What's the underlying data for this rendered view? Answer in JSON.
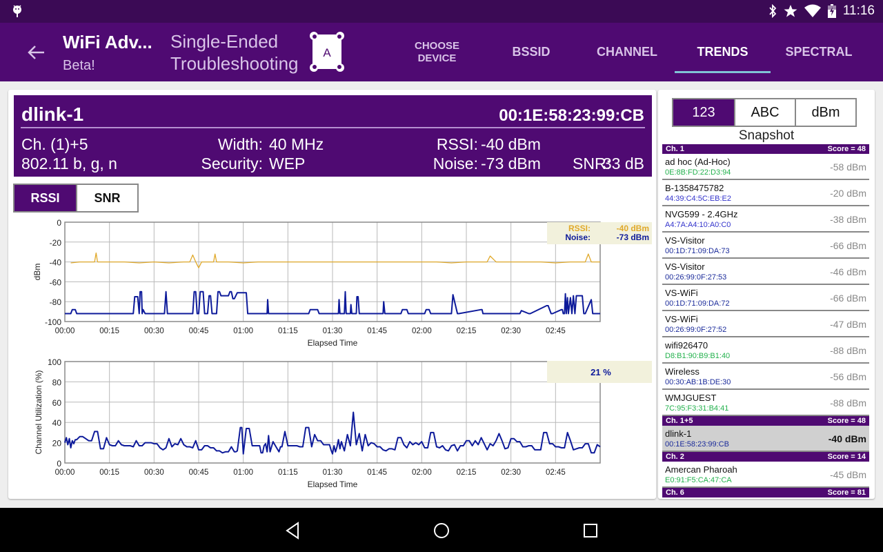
{
  "status_bar": {
    "time": "11:16",
    "icons": [
      "android-debug-icon",
      "bluetooth-icon",
      "star-icon",
      "wifi-icon",
      "battery-charging-icon"
    ]
  },
  "app_bar": {
    "title": "WiFi Adv...",
    "subtitle": "Beta!",
    "mode_line1": "Single-Ended",
    "mode_line2": "Troubleshooting",
    "device_badge": "A",
    "tabs": [
      {
        "label_line1": "CHOOSE",
        "label_line2": "DEVICE",
        "active": false
      },
      {
        "label": "BSSID",
        "active": false
      },
      {
        "label": "CHANNEL",
        "active": false
      },
      {
        "label": "TRENDS",
        "active": true
      },
      {
        "label": "SPECTRAL",
        "active": false
      }
    ]
  },
  "network_info": {
    "ssid": "dlink-1",
    "bssid": "00:1E:58:23:99:CB",
    "channel": "Ch. (1)+5",
    "standards": "802.11 b, g, n",
    "width_label": "Width:",
    "width_value": "40 MHz",
    "security_label": "Security:",
    "security_value": "WEP",
    "rssi_label": "RSSI:",
    "rssi_value": "-40 dBm",
    "noise_label": "Noise:",
    "noise_value": "-73 dBm",
    "snr_label": "SNR:",
    "snr_value": "33 dB"
  },
  "chart_toggle": {
    "options": [
      "RSSI",
      "SNR"
    ],
    "selected": "RSSI"
  },
  "colors": {
    "brand": "#4f0a72",
    "rssi": "#e0a92a",
    "noise": "#0d1a9a",
    "legend_bg": "#f2f1dc"
  },
  "chart_data": [
    {
      "type": "line",
      "title": "",
      "xlabel": "Elapsed Time",
      "ylabel": "dBm",
      "ylim": [
        -100,
        0
      ],
      "xlim_minutes": [
        0,
        180
      ],
      "yticks": [
        "0",
        "-20",
        "-40",
        "-60",
        "-80",
        "-100"
      ],
      "xticks": [
        "00:00",
        "00:15",
        "00:30",
        "00:45",
        "01:00",
        "01:15",
        "01:30",
        "01:45",
        "02:00",
        "02:15",
        "02:30",
        "02:45"
      ],
      "grid": true,
      "legend": {
        "placement": "top-right",
        "entries": [
          {
            "label": "RSSI:",
            "value": "-40 dBm"
          },
          {
            "label": "Noise:",
            "value": "-73 dBm"
          }
        ]
      },
      "series": [
        {
          "name": "RSSI",
          "x_minutes": [
            2,
            5,
            8,
            10,
            10.5,
            11,
            14,
            20,
            25,
            30,
            35,
            40,
            42,
            43,
            44,
            45,
            46,
            47,
            50,
            50.5,
            51,
            52,
            55,
            60,
            65,
            70,
            75,
            80,
            85,
            90,
            95,
            100,
            105,
            110,
            115,
            120,
            125,
            130,
            135,
            140,
            142,
            143,
            145,
            150,
            155,
            160,
            165,
            170,
            175,
            176,
            177,
            180
          ],
          "values": [
            -41,
            -40,
            -40,
            -40,
            -31,
            -40,
            -40,
            -40,
            -41,
            -40,
            -41,
            -40,
            -40,
            -33,
            -40,
            -46,
            -40,
            -40,
            -40,
            -32,
            -40,
            -40,
            -40,
            -41,
            -40,
            -40,
            -40,
            -40,
            -40,
            -40,
            -40,
            -40,
            -40,
            -40,
            -40,
            -40,
            -40,
            -41,
            -40,
            -40,
            -40,
            -34,
            -40,
            -40,
            -40,
            -40,
            -41,
            -40,
            -40,
            -32,
            -40,
            -40
          ]
        },
        {
          "name": "Noise",
          "x_minutes": [
            0,
            2,
            2.5,
            3.5,
            4,
            23,
            23.5,
            24.5,
            25,
            25.3,
            25.8,
            26,
            26.3,
            27,
            33.5,
            34,
            34.5,
            35,
            40,
            40.5,
            43,
            43.5,
            44,
            44.5,
            45,
            45.5,
            46.5,
            47,
            48,
            48.5,
            49,
            49.5,
            51,
            51.5,
            52,
            52.5,
            53,
            55,
            55.5,
            56,
            56.5,
            57,
            58,
            58.5,
            60,
            61,
            61.5,
            62,
            68,
            68.2,
            68.5,
            82,
            82.5,
            85,
            85.5,
            92,
            92.2,
            92.5,
            94,
            94.3,
            94.6,
            95,
            96,
            96.2,
            96.5,
            98,
            98.2,
            98.6,
            99,
            107,
            107.2,
            107.6,
            113,
            113.5,
            115,
            115.5,
            116,
            121,
            121.5,
            122.5,
            123,
            130,
            130.5,
            132,
            132.5,
            140,
            140.3,
            140.6,
            153,
            153.5,
            156,
            156.5,
            162,
            162.5,
            163.5,
            164,
            167,
            167.3,
            167.6,
            168,
            168.3,
            168.6,
            169,
            169.3,
            170,
            170.5,
            171,
            171.5,
            172,
            174,
            174.5,
            175,
            177,
            177.5,
            180
          ],
          "values": [
            -92,
            -92,
            -88,
            -88,
            -92,
            -92,
            -75,
            -75,
            -92,
            -70,
            -70,
            -92,
            -88,
            -92,
            -92,
            -70,
            -92,
            -92,
            -92,
            -92,
            -92,
            -70,
            -70,
            -92,
            -92,
            -70,
            -70,
            -92,
            -92,
            -74,
            -74,
            -92,
            -92,
            -70,
            -70,
            -74,
            -74,
            -74,
            -70,
            -70,
            -77,
            -77,
            -71,
            -71,
            -71,
            -71,
            -92,
            -92,
            -92,
            -78,
            -92,
            -92,
            -88,
            -88,
            -92,
            -92,
            -78,
            -92,
            -92,
            -70,
            -92,
            -92,
            -92,
            -83,
            -92,
            -92,
            -75,
            -75,
            -92,
            -92,
            -80,
            -92,
            -92,
            -88,
            -88,
            -92,
            -92,
            -92,
            -88,
            -88,
            -92,
            -92,
            -73,
            -92,
            -92,
            -88,
            -88,
            -92,
            -92,
            -89,
            -92,
            -92,
            -84,
            -84,
            -92,
            -92,
            -88,
            -88,
            -92,
            -92,
            -72,
            -92,
            -76,
            -92,
            -76,
            -92,
            -74,
            -92,
            -74,
            -74,
            -92,
            -92,
            -78,
            -92,
            -92,
            -79,
            -79
          ]
        }
      ]
    },
    {
      "type": "line",
      "title": "",
      "xlabel": "Elapsed Time",
      "ylabel": "Channel Utilization (%)",
      "ylim": [
        0,
        100
      ],
      "xlim_minutes": [
        0,
        180
      ],
      "yticks": [
        "100",
        "80",
        "60",
        "40",
        "20",
        "0"
      ],
      "xticks": [
        "00:00",
        "00:15",
        "00:30",
        "00:45",
        "01:00",
        "01:15",
        "01:30",
        "01:45",
        "02:00",
        "02:15",
        "02:30",
        "02:45"
      ],
      "grid": true,
      "legend": {
        "placement": "top-right",
        "entries": [
          {
            "label": "",
            "value": "21 %"
          }
        ]
      },
      "series": [
        {
          "name": "Channel Utilization",
          "x_minutes": [
            0,
            0.5,
            1,
            1.5,
            2,
            2.5,
            3,
            3.5,
            4,
            5,
            6,
            7,
            8,
            9,
            10,
            11,
            12,
            13,
            14,
            15,
            16,
            17,
            18,
            19,
            20,
            21,
            22,
            23,
            24,
            25,
            26,
            27,
            28,
            29,
            30,
            31,
            32,
            33,
            34,
            35,
            36,
            37,
            38,
            39,
            40,
            41,
            42,
            43,
            44,
            45,
            46,
            47,
            48,
            49,
            50,
            51,
            52,
            53,
            54,
            55,
            56,
            57,
            57.5,
            58,
            59,
            59.5,
            60,
            61,
            62,
            63,
            64,
            65,
            65.5,
            66,
            66.5,
            67,
            67.5,
            68,
            68.5,
            69,
            70,
            71,
            72,
            72.5,
            73,
            74,
            75,
            76,
            77,
            78,
            79,
            80,
            81,
            82,
            83,
            84,
            85,
            86,
            87,
            88,
            88.5,
            89,
            89.5,
            90,
            90.5,
            91,
            91.5,
            92,
            92.5,
            93,
            94,
            95,
            96,
            97,
            98,
            99,
            100,
            101,
            102,
            103,
            104,
            105,
            106,
            107,
            108,
            109,
            110,
            111,
            112,
            113,
            114,
            115,
            116,
            117,
            118,
            119,
            120,
            121,
            122,
            123,
            124,
            125,
            126,
            127,
            128,
            129,
            130,
            131,
            132,
            133,
            134,
            135,
            136,
            137,
            138,
            139,
            140,
            141,
            142,
            143,
            144,
            145,
            146,
            147,
            148,
            149,
            150,
            151,
            152,
            153,
            154,
            155,
            156,
            157,
            158,
            159,
            160,
            161,
            162,
            163,
            164,
            165,
            166,
            167,
            168,
            169,
            170,
            171,
            172,
            173,
            174,
            175,
            176,
            177,
            178,
            179,
            180
          ],
          "values": [
            20,
            25,
            18,
            24,
            15,
            22,
            19,
            23,
            23,
            26,
            26,
            24,
            22,
            22,
            31,
            31,
            14,
            14,
            25,
            18,
            17,
            17,
            22,
            18,
            17,
            17,
            17,
            16,
            22,
            17,
            17,
            20,
            20,
            20,
            19,
            19,
            15,
            13,
            15,
            24,
            16,
            19,
            18,
            24,
            18,
            16,
            16,
            15,
            22,
            13,
            13,
            17,
            17,
            15,
            15,
            12,
            12,
            10,
            11,
            11,
            16,
            11,
            11,
            12,
            35,
            35,
            9,
            34,
            34,
            17,
            17,
            17,
            17,
            10,
            10,
            17,
            19,
            11,
            27,
            11,
            21,
            16,
            11,
            16,
            16,
            31,
            17,
            17,
            17,
            17,
            16,
            16,
            35,
            35,
            16,
            28,
            22,
            22,
            18,
            18,
            18,
            18,
            13,
            9,
            17,
            11,
            16,
            23,
            14,
            21,
            12,
            28,
            17,
            50,
            18,
            29,
            12,
            28,
            17,
            20,
            19,
            16,
            16,
            13,
            12,
            14,
            14,
            13,
            25,
            25,
            18,
            15,
            21,
            18,
            20,
            18,
            21,
            15,
            15,
            30,
            30,
            16,
            15,
            17,
            13,
            12,
            17,
            18,
            12,
            17,
            17,
            22,
            22,
            17,
            22,
            18,
            25,
            19,
            13,
            19,
            17,
            22,
            29,
            22,
            14,
            15,
            24,
            24,
            21,
            21,
            16,
            16,
            17,
            17,
            13,
            13,
            13,
            30,
            30,
            19,
            19,
            16,
            16,
            15,
            15,
            30,
            22,
            13,
            14,
            15,
            15,
            19,
            19,
            10,
            10,
            18,
            16,
            16,
            16,
            16,
            16,
            17,
            17,
            17,
            17,
            14,
            14,
            11,
            11,
            11,
            11,
            14,
            15,
            15,
            15,
            10,
            10,
            20,
            20,
            21,
            21
          ]
        }
      ]
    }
  ],
  "sidebar": {
    "sort_options": [
      "123",
      "ABC",
      "dBm"
    ],
    "sort_selected": "123",
    "title": "Snapshot",
    "groups": [
      {
        "channel": "Ch. 1",
        "score": "Score = 48",
        "networks": [
          {
            "name": "ad hoc (Ad-Hoc)",
            "mac": "0E:8B:FD:22:D3:94",
            "mac_color": "#22b14c",
            "dbm": "-58 dBm"
          },
          {
            "name": "B-1358475782",
            "mac": "44:39:C4:5C:EB:E2",
            "mac_color": "#3333cc",
            "dbm": "-20 dBm"
          },
          {
            "name": "NVG599 - 2.4GHz",
            "mac": "A4:7A:A4:10:A0:C0",
            "mac_color": "#3333cc",
            "dbm": "-38 dBm"
          },
          {
            "name": "VS-Visitor",
            "mac": "00:1D:71:09:DA:73",
            "mac_color": "#1a2a9a",
            "dbm": "-66 dBm"
          },
          {
            "name": "VS-Visitor",
            "mac": "00:26:99:0F:27:53",
            "mac_color": "#1a2a9a",
            "dbm": "-46 dBm"
          },
          {
            "name": "VS-WiFi",
            "mac": "00:1D:71:09:DA:72",
            "mac_color": "#1a2a9a",
            "dbm": "-66 dBm"
          },
          {
            "name": "VS-WiFi",
            "mac": "00:26:99:0F:27:52",
            "mac_color": "#1a2a9a",
            "dbm": "-47 dBm"
          },
          {
            "name": "wifi926470",
            "mac": "D8:B1:90:B9:B1:40",
            "mac_color": "#22b14c",
            "dbm": "-88 dBm"
          },
          {
            "name": "Wireless",
            "mac": "00:30:AB:1B:DE:30",
            "mac_color": "#1a2a9a",
            "dbm": "-56 dBm"
          },
          {
            "name": "WMJGUEST",
            "mac": "7C:95:F3:31:B4:41",
            "mac_color": "#22b14c",
            "dbm": "-88 dBm"
          }
        ]
      },
      {
        "channel": "Ch. 1+5",
        "score": "Score = 48",
        "networks": [
          {
            "name": "dlink-1",
            "mac": "00:1E:58:23:99:CB",
            "mac_color": "#1a2a9a",
            "dbm": "-40 dBm",
            "selected": true
          }
        ]
      },
      {
        "channel": "Ch. 2",
        "score": "Score = 14",
        "networks": [
          {
            "name": "Amercan Pharoah",
            "mac": "E0:91:F5:CA:47:CA",
            "mac_color": "#22b14c",
            "dbm": "-45 dBm"
          }
        ]
      },
      {
        "channel": "Ch. 6",
        "score": "Score = 81",
        "networks": []
      }
    ]
  },
  "nav_bar": {
    "buttons": [
      "back",
      "home",
      "recents"
    ]
  }
}
